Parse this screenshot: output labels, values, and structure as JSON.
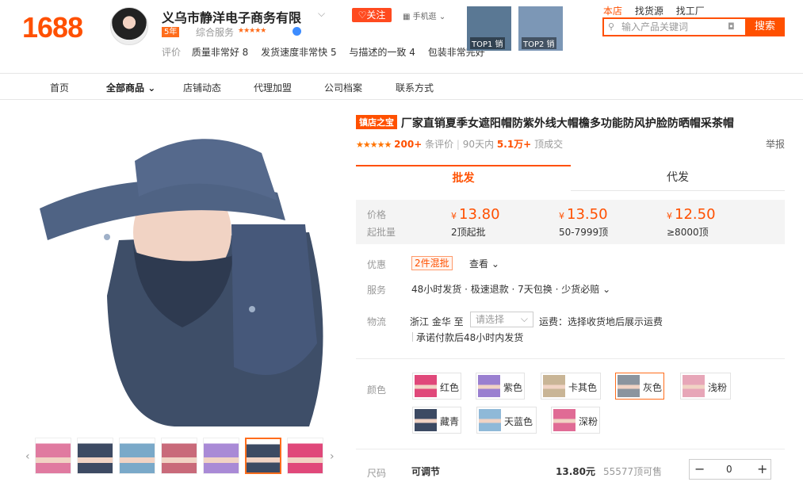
{
  "logo": "1688",
  "shop": {
    "name": "义乌市静洋电子商务有限",
    "follow": "关注",
    "mobile": "手机逛",
    "years": "5年",
    "service_label": "综合服务",
    "service_stars": "★★★★★",
    "ratings_label": "评价",
    "ratings": [
      "质量非常好 8",
      "发货速度非常快 5",
      "与描述的一致 4",
      "包装非常完好"
    ]
  },
  "top_products": [
    {
      "label": "TOP1 销",
      "color": "#5a7894"
    },
    {
      "label": "TOP2 销",
      "color": "#7c97b6"
    }
  ],
  "search": {
    "tabs": [
      "本店",
      "找货源",
      "找工厂"
    ],
    "placeholder": "输入产品关键词",
    "button": "搜索"
  },
  "nav": [
    "首页",
    "全部商品",
    "店铺动态",
    "代理加盟",
    "公司档案",
    "联系方式"
  ],
  "product": {
    "badge": "镇店之宝",
    "title": "厂家直销夏季女遮阳帽防紫外线大帽檐多功能防风护脸防晒帽采茶帽",
    "stars": "★★★★★",
    "review_count": "200+",
    "review_label": "条评价",
    "days_label": "90天内",
    "sold": "5.1万+",
    "sold_label": "顶成交",
    "report": "举报"
  },
  "tabs": [
    "批发",
    "代发"
  ],
  "price": {
    "label": "价格",
    "moq_label": "起批量",
    "currency": "¥",
    "tiers": [
      {
        "price": "13.80",
        "qty": "2顶起批"
      },
      {
        "price": "13.50",
        "qty": "50-7999顶"
      },
      {
        "price": "12.50",
        "qty": "≥8000顶"
      }
    ]
  },
  "promo": {
    "label": "优惠",
    "tag": "2件混批",
    "view": "查看"
  },
  "service": {
    "label": "服务",
    "text": "48小时发货 · 极速退款 · 7天包换 · 少货必赔"
  },
  "logistics": {
    "label": "物流",
    "origin": "浙江 金华 至",
    "select": "请选择",
    "freight": "运费：选择收货地后展示运费",
    "ship": "承诺付款后48小时内发货"
  },
  "colors": {
    "label": "颜色",
    "items": [
      {
        "name": "红色",
        "color": "#e0487a",
        "selected": false
      },
      {
        "name": "紫色",
        "color": "#9a7fd0",
        "selected": false
      },
      {
        "name": "卡其色",
        "color": "#c9b596",
        "selected": false
      },
      {
        "name": "灰色",
        "color": "#8b949e",
        "selected": true
      },
      {
        "name": "浅粉",
        "color": "#e7a6b8",
        "selected": false
      },
      {
        "name": "藏青",
        "color": "#3c4a63",
        "selected": false
      },
      {
        "name": "天蓝色",
        "color": "#8fb9d8",
        "selected": false
      },
      {
        "name": "深粉",
        "color": "#e06b95",
        "selected": false
      }
    ]
  },
  "size": {
    "label": "尺码",
    "value": "可调节",
    "price": "13.80元",
    "stock": "55577顶可售",
    "qty": "0"
  },
  "thumbs": [
    "#e07aa0",
    "#3d4a63",
    "#7aa9c9",
    "#c96a7a",
    "#a98ad6",
    "#3c4a63",
    "#e0487a"
  ]
}
